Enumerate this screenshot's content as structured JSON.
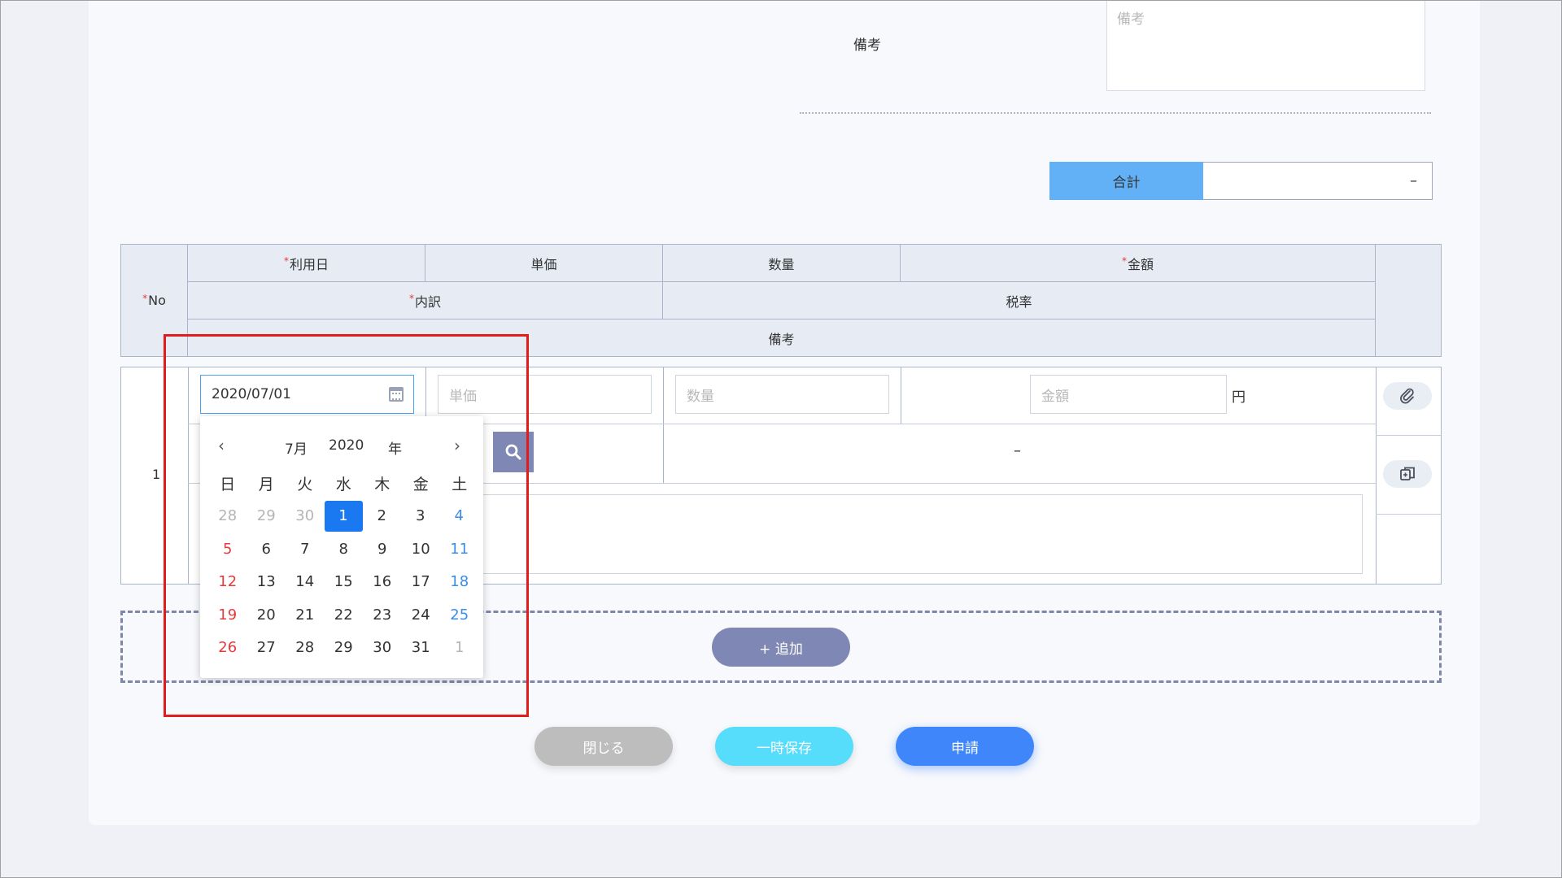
{
  "remarks": {
    "label": "備考",
    "placeholder": "備考"
  },
  "total": {
    "label": "合計",
    "value": "–"
  },
  "table_header": {
    "no": "No",
    "date": "利用日",
    "unit_price": "単価",
    "quantity": "数量",
    "amount": "金額",
    "breakdown": "内訳",
    "tax_rate": "税率",
    "remarks": "備考"
  },
  "row": {
    "no": "1",
    "date_value": "2020/07/01",
    "unit_price_placeholder": "単価",
    "quantity_placeholder": "数量",
    "amount_placeholder": "金額",
    "yen": "円",
    "tax_rate_value": "–"
  },
  "add_button": "+ 追加",
  "buttons": {
    "close": "閉じる",
    "save_draft": "一時保存",
    "apply": "申請"
  },
  "datepicker": {
    "month": "7月",
    "year": "2020",
    "year_suffix": "年",
    "prev": "‹",
    "next": "›",
    "weekdays": [
      "日",
      "月",
      "火",
      "水",
      "木",
      "金",
      "土"
    ],
    "weeks": [
      [
        "28",
        "29",
        "30",
        "1",
        "2",
        "3",
        "4"
      ],
      [
        "5",
        "6",
        "7",
        "8",
        "9",
        "10",
        "11"
      ],
      [
        "12",
        "13",
        "14",
        "15",
        "16",
        "17",
        "18"
      ],
      [
        "19",
        "20",
        "21",
        "22",
        "23",
        "24",
        "25"
      ],
      [
        "26",
        "27",
        "28",
        "29",
        "30",
        "31",
        "1"
      ]
    ],
    "selected_day": "1",
    "colors": {
      "selected": "#1a79f0",
      "sunday": "#e83a3a",
      "saturday": "#3a8de8",
      "outside_month": "#b5b5b5"
    }
  },
  "colors": {
    "total_label_bg": "#62b1f6",
    "add_button_bg": "#7f87b4",
    "apply_button_bg": "#3f86fb",
    "save_button_bg": "#55ddfb",
    "close_button_bg": "#bdbdbd",
    "highlight_box": "#e21b1b"
  }
}
